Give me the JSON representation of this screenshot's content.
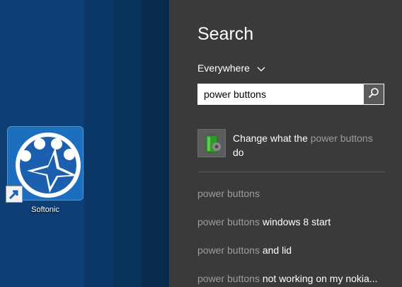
{
  "desktop": {
    "shortcut": {
      "label": "Softonic",
      "icon": "softonic-app-icon"
    }
  },
  "search_pane": {
    "title": "Search",
    "scope": {
      "value": "Everywhere",
      "icon": "chevron-down-icon"
    },
    "query": "power buttons",
    "search_button_icon": "search-icon",
    "top_result": {
      "prefix": "Change what the ",
      "highlight": "power buttons",
      "suffix": "do",
      "icon": "battery-settings-icon"
    },
    "suggestions": [
      {
        "highlight": "power buttons",
        "rest": ""
      },
      {
        "highlight": "power buttons",
        "rest": " windows 8 start"
      },
      {
        "highlight": "power buttons",
        "rest": " and lid"
      },
      {
        "highlight": "power buttons",
        "rest": " not working on my nokia..."
      }
    ]
  },
  "colors": {
    "pane_bg": "#3a3a3a",
    "dim_text": "#9d9d9d",
    "desktop_bg": "#0d3f74",
    "app_tile": "#1c6fbf"
  }
}
